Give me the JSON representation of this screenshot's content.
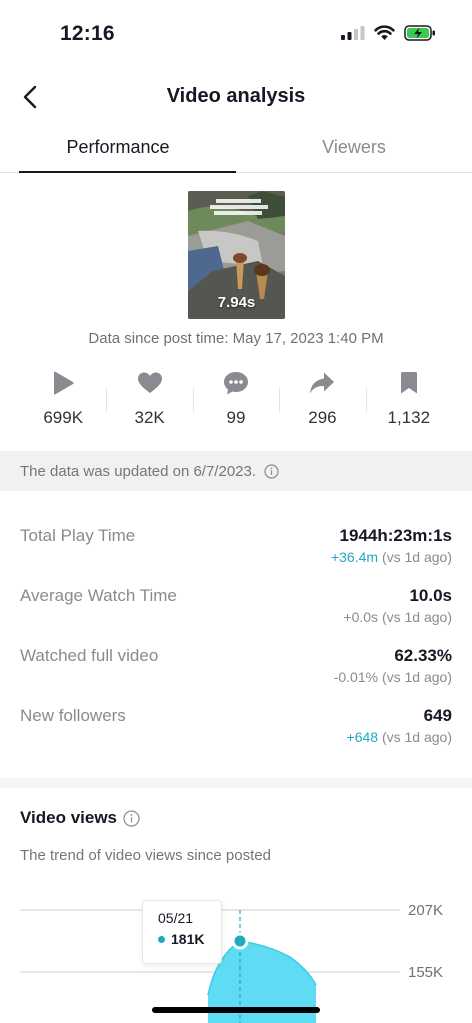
{
  "status_bar": {
    "time": "12:16"
  },
  "header": {
    "title": "Video analysis"
  },
  "tabs": [
    {
      "label": "Performance",
      "active": true
    },
    {
      "label": "Viewers",
      "active": false
    }
  ],
  "video": {
    "duration": "7.94s",
    "post_time": "Data since post time: May 17, 2023 1:40 PM"
  },
  "metrics": [
    {
      "icon": "play-icon",
      "value": "699K"
    },
    {
      "icon": "heart-icon",
      "value": "32K"
    },
    {
      "icon": "comment-icon",
      "value": "99"
    },
    {
      "icon": "share-icon",
      "value": "296"
    },
    {
      "icon": "bookmark-icon",
      "value": "1,132"
    }
  ],
  "updated_notice": "The data was updated on 6/7/2023.",
  "stats": [
    {
      "label": "Total Play Time",
      "value": "1944h:23m:1s",
      "delta": "+36.4m",
      "compare": " (vs 1d ago)",
      "delta_highlight": true
    },
    {
      "label": "Average Watch Time",
      "value": "10.0s",
      "delta": "+0.0s",
      "compare": " (vs 1d ago)",
      "delta_highlight": false
    },
    {
      "label": "Watched full video",
      "value": "62.33%",
      "delta": "-0.01%",
      "compare": " (vs 1d ago)",
      "delta_highlight": false
    },
    {
      "label": "New followers",
      "value": "649",
      "delta": "+648",
      "compare": " (vs 1d ago)",
      "delta_highlight": true
    }
  ],
  "video_views": {
    "title": "Video views",
    "subtitle": "The trend of video views since posted"
  },
  "chart_data": {
    "type": "area",
    "title": "",
    "y_tick_labels": [
      "207K",
      "155K"
    ],
    "selected_point": {
      "date": "05/21",
      "value": "181K"
    },
    "series_color": "#5fdcf3",
    "accent_color": "#20a9c3",
    "grid": true
  },
  "colors": {
    "accent": "#20a9c3",
    "text": "#161823",
    "muted": "#8a8b91"
  }
}
